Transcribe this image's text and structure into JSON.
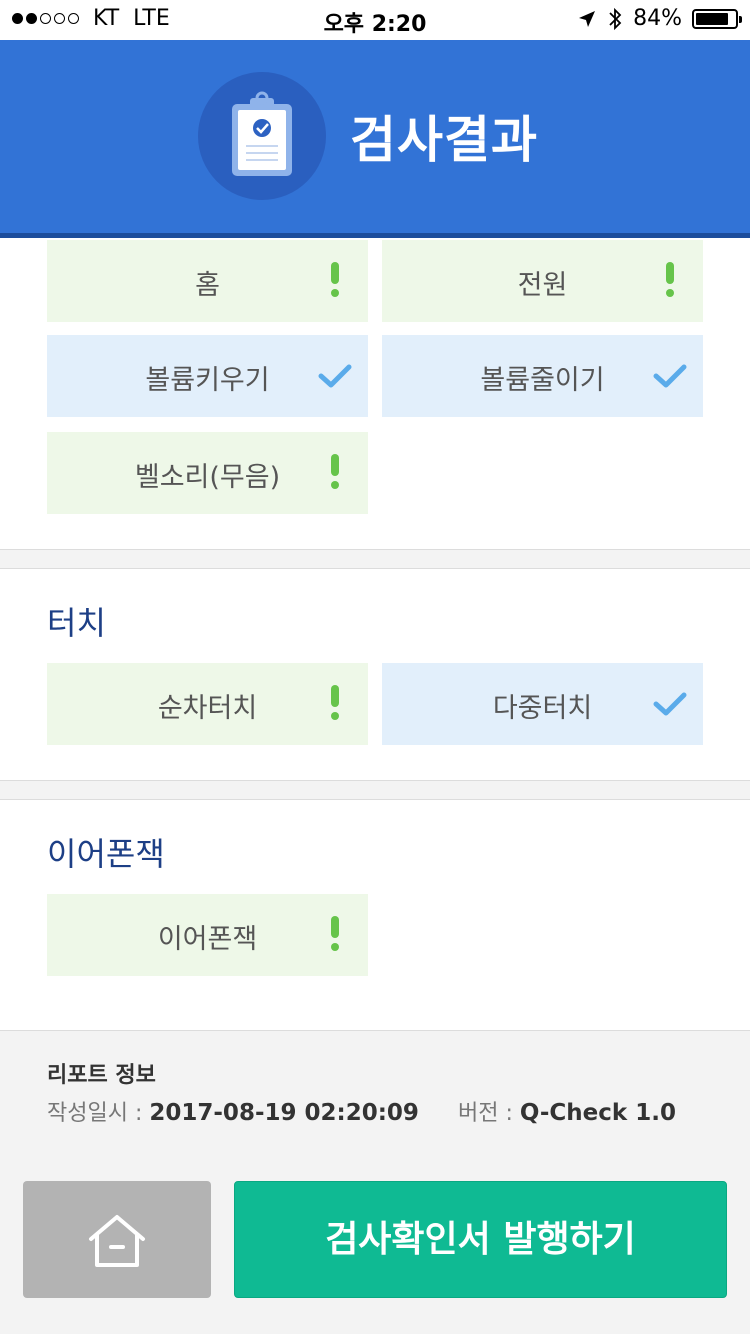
{
  "status_bar": {
    "carrier": "KT",
    "network": "LTE",
    "time": "오후 2:20",
    "battery": "84%",
    "battery_level": 0.84,
    "signal_bars": 2,
    "signal_total": 5,
    "icons": [
      "location-arrow-icon",
      "bluetooth-icon",
      "battery-icon"
    ]
  },
  "header": {
    "title": "검사결과",
    "icon": "clipboard-check-icon",
    "colors": {
      "background": "#3273d6",
      "circle": "#2a5fbf"
    }
  },
  "sections": [
    {
      "id": "buttons",
      "title": "",
      "items": [
        {
          "label": "홈",
          "status": "fail",
          "icon": "exclamation-icon"
        },
        {
          "label": "전원",
          "status": "fail",
          "icon": "exclamation-icon"
        },
        {
          "label": "볼륨키우기",
          "status": "pass",
          "icon": "checkmark-icon"
        },
        {
          "label": "볼륨줄이기",
          "status": "pass",
          "icon": "checkmark-icon"
        },
        {
          "label": "벨소리(무음)",
          "status": "fail",
          "icon": "exclamation-icon"
        }
      ]
    },
    {
      "id": "touch",
      "title": "터치",
      "items": [
        {
          "label": "순차터치",
          "status": "fail",
          "icon": "exclamation-icon"
        },
        {
          "label": "다중터치",
          "status": "pass",
          "icon": "checkmark-icon"
        }
      ]
    },
    {
      "id": "earphone",
      "title": "이어폰잭",
      "items": [
        {
          "label": "이어폰잭",
          "status": "fail",
          "icon": "exclamation-icon"
        }
      ]
    }
  ],
  "report": {
    "heading": "리포트 정보",
    "created_label": "작성일시 :",
    "created_value": "2017-08-19 02:20:09",
    "version_label": "버전 :",
    "version_value": "Q-Check 1.0"
  },
  "actions": {
    "home_icon": "home-icon",
    "issue_label": "검사확인서 발행하기",
    "colors": {
      "home": "#b3b3b3",
      "issue": "#0fba93"
    }
  },
  "colors": {
    "fail_bg": "#eef8e8",
    "pass_bg": "#e2effb",
    "fail_icon": "#66c44a",
    "pass_icon": "#5aabea",
    "section_title": "#1d3f86"
  }
}
